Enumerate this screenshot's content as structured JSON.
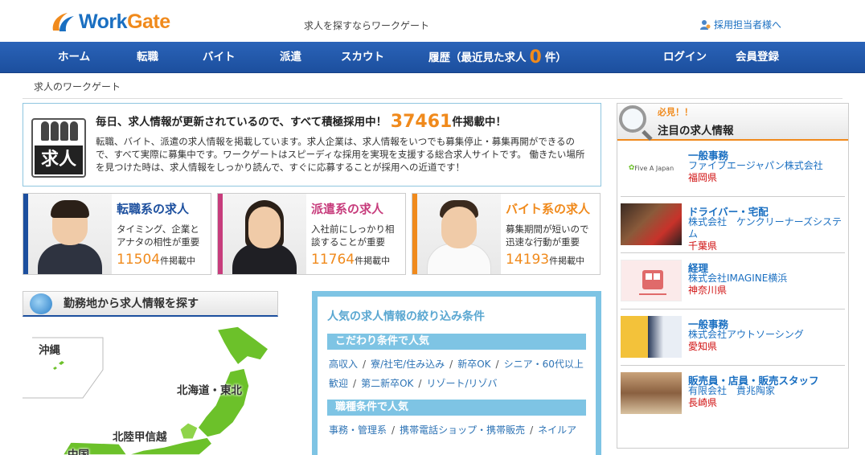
{
  "header": {
    "logo": "WorkGate",
    "tagline": "求人を探すならワークゲート",
    "recruiter_link": "採用担当者様へ"
  },
  "nav": {
    "home": "ホーム",
    "career": "転職",
    "parttime": "バイト",
    "dispatch": "派遣",
    "scout": "スカウト",
    "history_prefix": "履歴（最近見た求人",
    "history_count": "0",
    "history_suffix": "件）",
    "login": "ログイン",
    "register": "会員登録"
  },
  "breadcrumb": "求人のワークゲート",
  "intro": {
    "icon_text": "求人",
    "headline_prefix": "毎日、求人情報が更新されているので、すべて積極採用中！",
    "total_count": "37461",
    "headline_suffix": "件掲載中！",
    "body": "転職、バイト、派遣の求人情報を掲載しています。求人企業は、求人情報をいつでも募集停止・募集再開ができるので、すべて実際に募集中です。ワークゲートはスピーディな採用を実現を支援する総合求人サイトです。 働きたい場所を見つけた時は、求人情報をしっかり読んで、すぐに応募することが採用への近道です！"
  },
  "categories": [
    {
      "title": "転職系の求人",
      "desc": "タイミング、企業とアナタの相性が重要",
      "count": "11504",
      "unit": "件掲載中",
      "color": "#1c4f9e"
    },
    {
      "title": "派遣系の求人",
      "desc": "入社前にしっかり相談することが重要",
      "count": "11764",
      "unit": "件掲載中",
      "color": "#c73c7c"
    },
    {
      "title": "バイト系の求人",
      "desc": "募集期間が短いので迅速な行動が重要",
      "count": "14193",
      "unit": "件掲載中",
      "color": "#f08a1c"
    }
  ],
  "map": {
    "heading": "勤務地から求人情報を探す",
    "regions": [
      "沖縄",
      "北海道・東北",
      "北陸甲信越",
      "中国"
    ]
  },
  "search_panel": {
    "title": "人気の求人情報の絞り込み条件",
    "section1": "こだわり条件で人気",
    "links1": [
      "高収入",
      "寮/社宅/住み込み",
      "新卒OK",
      "シニア・60代以上歓迎",
      "第二新卒OK",
      "リゾート/リゾバ"
    ],
    "section2": "職種条件で人気",
    "links2": [
      "事務・管理系",
      "携帯電話ショップ・携帯販売",
      "ネイルア"
    ]
  },
  "featured": {
    "badge": "必見！！",
    "title": "注目の求人情報",
    "jobs": [
      {
        "job": "一般事務",
        "company": "ファイブエージャパン株式会社",
        "location": "福岡県",
        "thumb_text": "Five A Japan"
      },
      {
        "job": "ドライバー・宅配",
        "company": "株式会社　ケンクリーナーズシステム",
        "location": "千葉県",
        "thumb_text": ""
      },
      {
        "job": "経理",
        "company": "株式会社IMAGINE横浜",
        "location": "神奈川県",
        "thumb_text": ""
      },
      {
        "job": "一般事務",
        "company": "株式会社アウトソーシング",
        "location": "愛知県",
        "thumb_text": ""
      },
      {
        "job": "販売員・店員・販売スタッフ",
        "company": "有限会社　貴兆陶家",
        "location": "長崎県",
        "thumb_text": ""
      }
    ]
  },
  "colors": {
    "brand_blue": "#1c4f9e",
    "accent_orange": "#f08a1c",
    "light_blue": "#7ec4e4",
    "pink": "#c73c7c",
    "link_blue": "#1a6fc1",
    "location_red": "#d01010"
  }
}
